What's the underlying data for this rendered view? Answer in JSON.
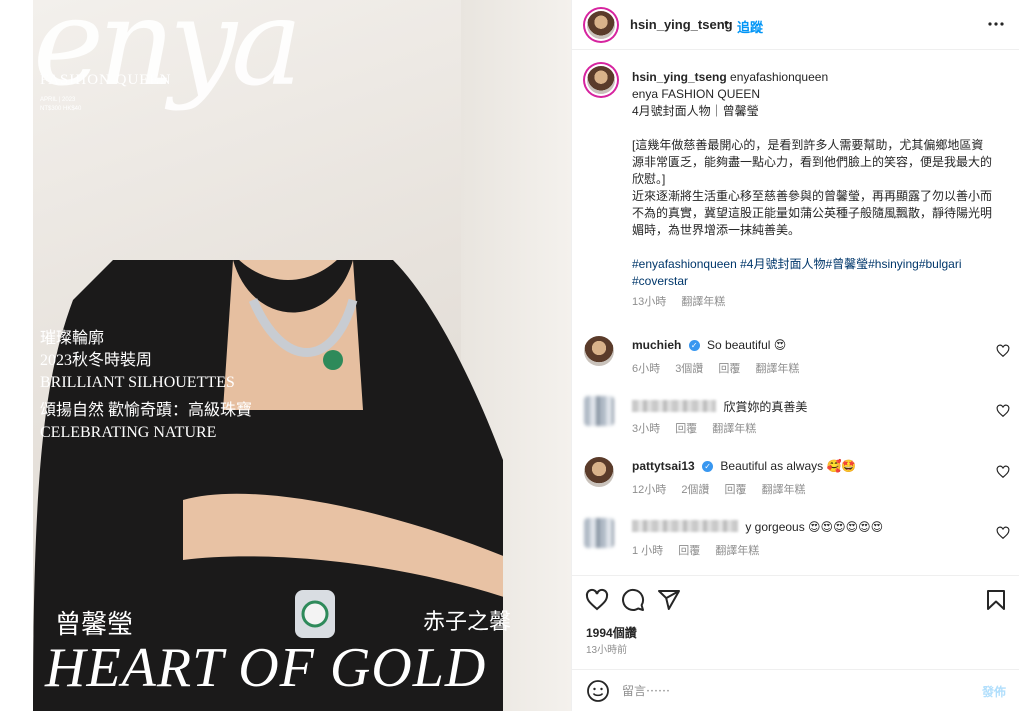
{
  "cover": {
    "logo": "enya",
    "brand": "FASHION QUEEN",
    "issue_line1": "APRIL | 2023",
    "issue_line2": "NT$300 HK$40",
    "headline1_line1": "璀璨輪廓",
    "headline1_line2": "2023秋冬時裝周",
    "headline1_line3": "BRILLIANT SILHOUETTES",
    "headline2_line1": "頌揚自然 歡愉奇蹟：高級珠寶",
    "headline2_line2": "CELEBRATING NATURE",
    "cover_name": "曾馨瑩",
    "cover_subname": "赤子之馨",
    "cover_title": "HEART OF GOLD"
  },
  "header": {
    "username": "hsin_ying_tseng",
    "separator": "•",
    "follow_label": "追蹤"
  },
  "caption": {
    "username": "hsin_ying_tseng",
    "mention": "enyafashionqueen",
    "line1": "enya FASHION QUEEN",
    "line2": "4月號封面人物｜曾馨瑩",
    "quote": "[這幾年做慈善最開心的，是看到許多人需要幫助，尤其偏鄉地區資源非常匱乏，能夠盡一點心力，看到他們臉上的笑容，便是我最大的欣慰。]",
    "body": "近來逐漸將生活重心移至慈善參與的曾馨瑩，再再顯露了勿以善小而不為的真實，冀望這股正能量如蒲公英種子般隨風飄散，靜待陽光明媚時，為世界增添一抹純善美。",
    "hashtags": "#enyafashionqueen #4月號封面人物#曾馨瑩#hsinying#bulgari #coverstar",
    "time": "13小時",
    "translate": "翻譯年糕"
  },
  "comments": [
    {
      "username": "muchieh",
      "verified": true,
      "text": "So beautiful 😍",
      "time": "6小時",
      "likes": "3個讚",
      "reply": "回覆",
      "translate": "翻譯年糕"
    },
    {
      "username": "",
      "verified": false,
      "text": "欣賞妳的真善美",
      "time": "3小時",
      "likes": "",
      "reply": "回覆",
      "translate": "翻譯年糕"
    },
    {
      "username": "pattytsai13",
      "verified": true,
      "text": "Beautiful as always 🥰🤩",
      "time": "12小時",
      "likes": "2個讚",
      "reply": "回覆",
      "translate": "翻譯年糕"
    },
    {
      "username": "",
      "verified": false,
      "text": "y gorgeous 😍😍😍😍😍😍",
      "time": "1 小時",
      "likes": "",
      "reply": "回覆",
      "translate": "翻譯年糕"
    }
  ],
  "actions": {
    "likes": "1994個讚",
    "ago": "13小時前"
  },
  "add_comment": {
    "placeholder": "留言⋯⋯",
    "post_label": "發佈"
  },
  "colors": {
    "link_blue": "#0095f6",
    "hashtag": "#00376b",
    "post_disabled": "#b2dffc",
    "story_ring": "#d6249f",
    "meta_gray": "#8e8e8e"
  },
  "icons": [
    "more-icon",
    "heart-icon",
    "comment-icon",
    "share-icon",
    "bookmark-icon",
    "emoji-icon",
    "verified-icon"
  ]
}
